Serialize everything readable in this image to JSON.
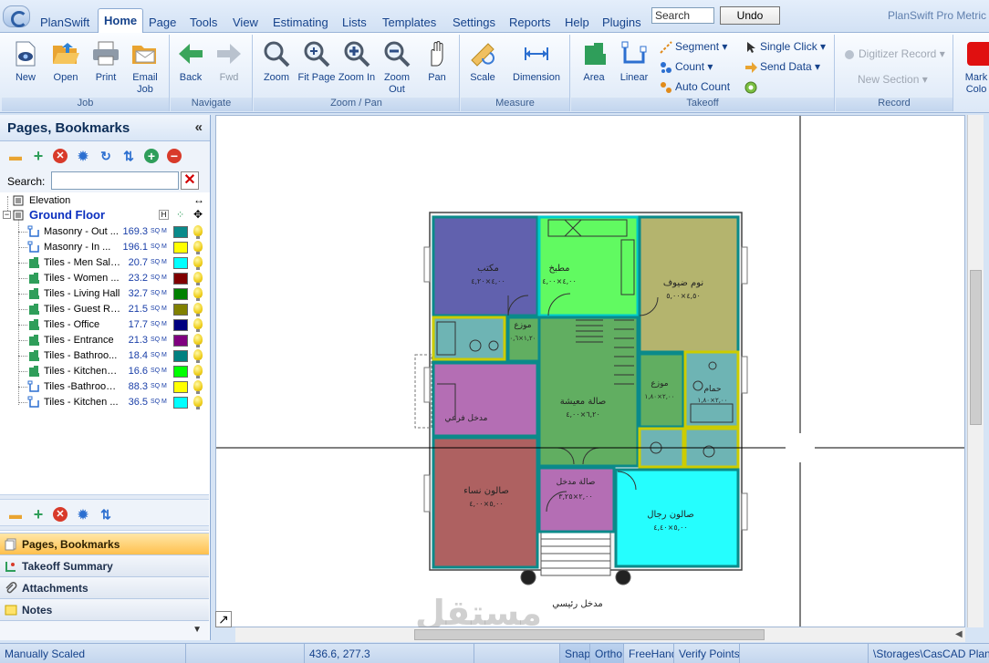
{
  "app": {
    "name": "PlanSwift",
    "product": "PlanSwift Pro Metric"
  },
  "menu": {
    "tabs": [
      "Home",
      "Page",
      "Tools",
      "View",
      "Estimating",
      "Lists",
      "Templates",
      "Settings",
      "Reports",
      "Help",
      "Plugins"
    ],
    "active_tab": "Home",
    "search_value": "Search",
    "undo_label": "Undo"
  },
  "ribbon": {
    "job": {
      "label": "Job",
      "new": "New",
      "open": "Open",
      "print": "Print",
      "email": "Email Job"
    },
    "navigate": {
      "label": "Navigate",
      "back": "Back",
      "fwd": "Fwd"
    },
    "zoom": {
      "label": "Zoom / Pan",
      "zoom": "Zoom",
      "fit": "Fit Page",
      "zin": "Zoom In",
      "zout": "Zoom Out",
      "pan": "Pan"
    },
    "measure": {
      "label": "Measure",
      "scale": "Scale",
      "dimension": "Dimension"
    },
    "takeoff": {
      "label": "Takeoff",
      "area": "Area",
      "linear": "Linear",
      "segment": "Segment",
      "count": "Count",
      "auto_count": "Auto Count",
      "single_click": "Single Click",
      "send_data": "Send Data"
    },
    "record": {
      "label": "Record",
      "digitizer": "Digitizer Record",
      "new_section": "New Section"
    },
    "mark": {
      "label": "Mark Colo"
    }
  },
  "left_panel": {
    "title": "Pages, Bookmarks",
    "search_label": "Search:",
    "pages": [
      {
        "name": "Elevation"
      },
      {
        "name": "Ground Floor"
      }
    ],
    "items": [
      {
        "name": "Masonry - Out ...",
        "qty": "169.3",
        "unit": "SQ M",
        "color": "#0a8a8a",
        "type": "linear"
      },
      {
        "name": "Masonry - In ...",
        "qty": "196.1",
        "unit": "SQ M",
        "color": "#ffff00",
        "type": "linear"
      },
      {
        "name": "Tiles - Men Saloon",
        "qty": "20.7",
        "unit": "SQ M",
        "color": "#00ffff",
        "type": "area"
      },
      {
        "name": "Tiles - Women ...",
        "qty": "23.2",
        "unit": "SQ M",
        "color": "#800000",
        "type": "area"
      },
      {
        "name": "Tiles - Living Hall",
        "qty": "32.7",
        "unit": "SQ M",
        "color": "#008000",
        "type": "area"
      },
      {
        "name": "Tiles - Guest Ro...",
        "qty": "21.5",
        "unit": "SQ M",
        "color": "#808000",
        "type": "area"
      },
      {
        "name": "Tiles - Office",
        "qty": "17.7",
        "unit": "SQ M",
        "color": "#000080",
        "type": "area"
      },
      {
        "name": "Tiles - Entrance",
        "qty": "21.3",
        "unit": "SQ M",
        "color": "#800080",
        "type": "area"
      },
      {
        "name": "Tiles - Bathroo...",
        "qty": "18.4",
        "unit": "SQ M",
        "color": "#008080",
        "type": "area"
      },
      {
        "name": "Tiles - KitchenFl...",
        "qty": "16.6",
        "unit": "SQ M",
        "color": "#00ff00",
        "type": "area"
      },
      {
        "name": "Tiles -Bathroom...",
        "qty": "88.3",
        "unit": "SQ M",
        "color": "#ffff00",
        "type": "linear"
      },
      {
        "name": "Tiles - Kitchen ...",
        "qty": "36.5",
        "unit": "SQ M",
        "color": "#00ffff",
        "type": "linear"
      }
    ],
    "nav": [
      "Pages, Bookmarks",
      "Takeoff Summary",
      "Attachments",
      "Notes"
    ]
  },
  "plan": {
    "rooms": [
      {
        "label": "مكتب",
        "sub": "٤,٠٠×٤,٢٠",
        "color": "#000080"
      },
      {
        "label": "مطبخ",
        "sub": "٤,٠٠×٤,٠٠",
        "color": "#00ff00"
      },
      {
        "label": "نوم ضيوف",
        "sub": "٤,٥٠×٥,٠٠",
        "color": "#808000"
      },
      {
        "label": "موزع",
        "sub": "١,٢٠×٠,٦",
        "color": "#008000"
      },
      {
        "label": "صالة معيشة",
        "sub": "٦,٢٠×٤,٠٠",
        "color": "#008000"
      },
      {
        "label": "مدخل فرعي",
        "sub": "",
        "color": "#800080"
      },
      {
        "label": "موزع",
        "sub": "٢,٠٠×١,٨٠",
        "color": "#008000"
      },
      {
        "label": "حمام",
        "sub": "٢,٠٠×١,٨٠",
        "color": "#008080"
      },
      {
        "label": "صالون نساء",
        "sub": "٥,٠٠×٤,٠٠",
        "color": "#800000"
      },
      {
        "label": "صالة مدخل",
        "sub": "٢,٠٠×٣,٢٥",
        "color": "#800080"
      },
      {
        "label": "صالون رجال",
        "sub": "٥,٠٠×٤,٤٠",
        "color": "#00ffff"
      }
    ],
    "entrance_label": "مدخل رئيسي",
    "watermark": "مستقل"
  },
  "status": {
    "scale": "Manually Scaled",
    "coords": "436.6, 277.3",
    "snap": "Snap",
    "ortho": "Ortho",
    "freehand": "FreeHand",
    "verify": "Verify Points",
    "path": "\\Storages\\CasCAD PlanSw"
  }
}
